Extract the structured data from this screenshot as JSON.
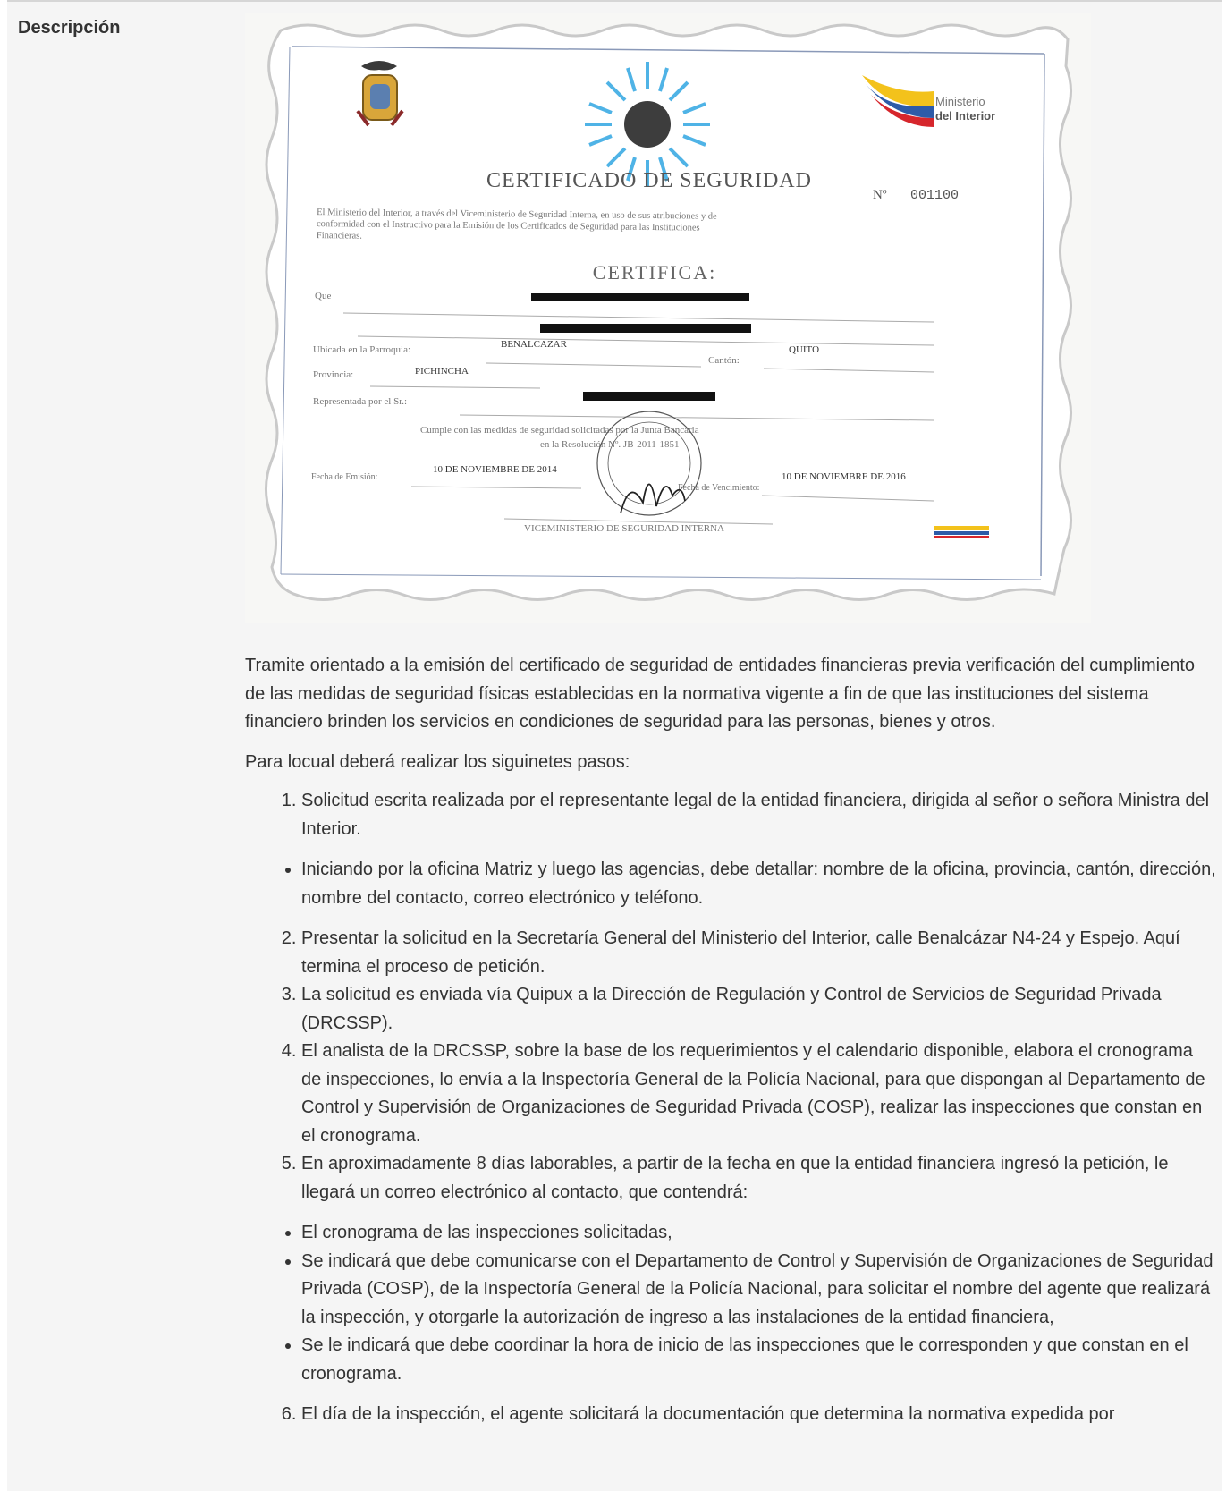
{
  "section_label": "Descripción",
  "certificate": {
    "title": "CERTIFICADO DE SEGURIDAD",
    "number_label": "Nº",
    "number": "001100",
    "ministry_line1": "Ministerio",
    "ministry_line2": "del Interior",
    "preamble_line1": "El Ministerio del Interior, a través del Viceministerio de Seguridad Interna, en uso de sus atribuciones y de",
    "preamble_line2": "conformidad con el Instructivo para la Emisión de los Certificados de Seguridad para las Instituciones",
    "preamble_line3": "Financieras.",
    "certifica": "CERTIFICA:",
    "que_label": "Que",
    "ubicada_label": "Ubicada en la Parroquia:",
    "parroquia": "BENALCAZAR",
    "canton_label": "Cantón:",
    "canton": "QUITO",
    "provincia_label": "Provincia:",
    "provincia": "PICHINCHA",
    "representada_label": "Representada por el Sr.:",
    "cumple_line1": "Cumple con las medidas de seguridad solicitadas por la Junta Bancaria",
    "cumple_line2": "en la Resolución Nº. JB-2011-1851",
    "fecha_emision_label": "Fecha de Emisión:",
    "fecha_emision": "10 DE NOVIEMBRE DE 2014",
    "fecha_venc_label": "Fecha de Vencimiento:",
    "fecha_venc": "10 DE NOVIEMBRE DE 2016",
    "signature_line": "VICEMINISTERIO DE SEGURIDAD INTERNA"
  },
  "intro": "Tramite orientado a la emisión del certificado de seguridad de entidades financieras previa verificación del cumplimiento de las medidas de seguridad físicas establecidas en la normativa vigente a fin de que las instituciones del sistema financiero brinden los servicios en condiciones de seguridad para las personas, bienes y otros.",
  "lead": "Para locual deberá realizar los siguinetes pasos:",
  "step1": "Solicitud escrita realizada por el representante legal de la entidad financiera, dirigida al señor o señora Ministra del Interior.",
  "bullet_a": "Iniciando por la oficina Matriz y luego las agencias, debe detallar: nombre de la oficina, provincia, cantón, dirección, nombre del contacto, correo electrónico y teléfono.",
  "step2": "Presentar la solicitud en la Secretaría General del Ministerio del Interior, calle Benalcázar N4-24 y Espejo. Aquí termina el proceso de petición.",
  "step3": "La solicitud es enviada vía Quipux a la Dirección de Regulación y Control de Servicios de Seguridad Privada (DRCSSP).",
  "step4": "El analista de la DRCSSP, sobre la base de los requerimientos y el calendario disponible, elabora el cronograma de inspecciones, lo envía a la Inspectoría General de la Policía Nacional, para que dispongan al Departamento de Control y Supervisión de Organizaciones de Seguridad Privada (COSP), realizar las inspecciones que constan en el cronograma.",
  "step5": "En aproximadamente 8 días laborables, a partir de la fecha en que la entidad financiera ingresó la petición, le llegará un correo electrónico al contacto, que contendrá:",
  "bullet_b1": "El cronograma de las inspecciones solicitadas,",
  "bullet_b2": "Se indicará que debe comunicarse con el Departamento de Control y Supervisión de Organizaciones de Seguridad Privada (COSP), de la Inspectoría General de la Policía Nacional, para solicitar el nombre del agente que realizará la inspección, y otorgarle la autorización de ingreso a las instalaciones de la entidad financiera,",
  "bullet_b3": "Se le indicará que debe coordinar la hora de inicio de las inspecciones que le corresponden y que constan en el cronograma.",
  "step6": "El día de la inspección, el agente solicitará la documentación que determina la normativa expedida por"
}
